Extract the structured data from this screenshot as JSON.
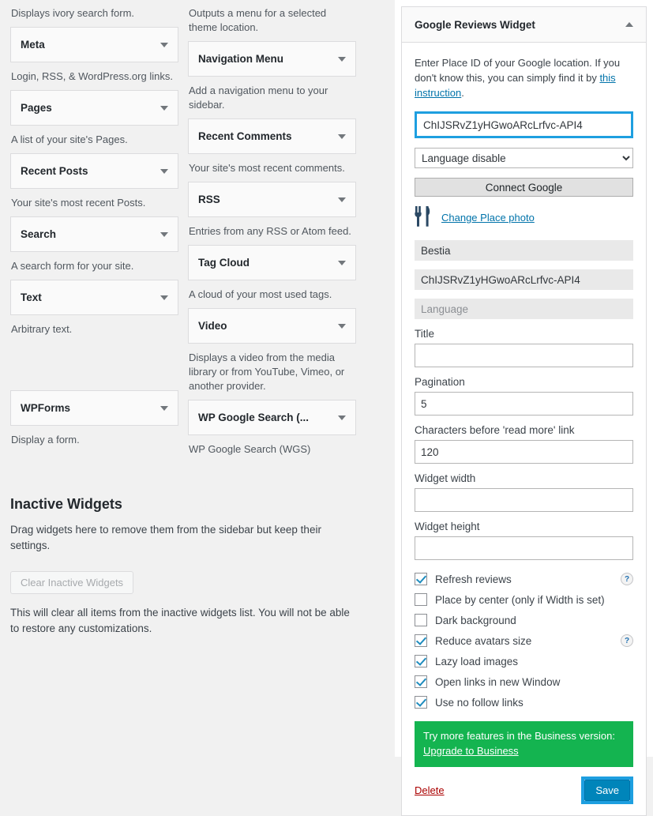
{
  "available_widgets": {
    "column_left": [
      {
        "desc_above": "Displays ivory search form.",
        "title": "Meta",
        "desc_below": "Login, RSS, & WordPress.org links."
      },
      {
        "title": "Pages",
        "desc_below": "A list of your site's Pages."
      },
      {
        "title": "Recent Posts",
        "desc_below": "Your site's most recent Posts."
      },
      {
        "title": "Search",
        "desc_below": "A search form for your site."
      },
      {
        "title": "Text",
        "desc_below": "Arbitrary text."
      },
      {
        "title": "WPForms",
        "desc_below": "Display a form."
      }
    ],
    "column_right": [
      {
        "desc_above": "Outputs a menu for a selected theme location.",
        "title": "Navigation Menu",
        "desc_below": "Add a navigation menu to your sidebar."
      },
      {
        "title": "Recent Comments",
        "desc_below": "Your site's most recent comments."
      },
      {
        "title": "RSS",
        "desc_below": "Entries from any RSS or Atom feed."
      },
      {
        "title": "Tag Cloud",
        "desc_below": "A cloud of your most used tags."
      },
      {
        "title": "Video",
        "desc_below": "Displays a video from the media library or from YouTube, Vimeo, or another provider."
      },
      {
        "title": "WP Google Search (...",
        "desc_below": "WP Google Search (WGS)"
      }
    ]
  },
  "inactive": {
    "heading": "Inactive Widgets",
    "description": "Drag widgets here to remove them from the sidebar but keep their settings.",
    "clear_button": "Clear Inactive Widgets",
    "note": "This will clear all items from the inactive widgets list. You will not be able to restore any customizations."
  },
  "widget_panel": {
    "title": "Google Reviews Widget",
    "collapse_icon": "chevron-up-icon",
    "intro_text_part1": "Enter Place ID of your Google location. If you don't know this, you can simply find it by ",
    "intro_link": "this instruction",
    "intro_text_part2": ".",
    "place_id_value": "ChIJSRvZ1yHGwoARcLrfvc-API4",
    "language_select_value": "Language disable",
    "language_options": [
      "Language disable"
    ],
    "connect_button": "Connect Google",
    "change_photo_link": "Change Place photo",
    "place_icon": "fork-and-knife-icon",
    "place_name_value": "Bestia",
    "place_id_readonly_value": "ChIJSRvZ1yHGwoARcLrfvc-API4",
    "language_placeholder": "Language",
    "fields": [
      {
        "label": "Title",
        "value": ""
      },
      {
        "label": "Pagination",
        "value": "5"
      },
      {
        "label": "Characters before 'read more' link",
        "value": "120"
      },
      {
        "label": "Widget width",
        "value": ""
      },
      {
        "label": "Widget height",
        "value": ""
      }
    ],
    "checkboxes": [
      {
        "label": "Refresh reviews",
        "checked": true,
        "help": "?"
      },
      {
        "label": "Place by center (only if Width is set)",
        "checked": false,
        "help": ""
      },
      {
        "label": "Dark background",
        "checked": false,
        "help": ""
      },
      {
        "label": "Reduce avatars size",
        "checked": true,
        "help": "?"
      },
      {
        "label": "Lazy load images",
        "checked": true,
        "help": ""
      },
      {
        "label": "Open links in new Window",
        "checked": true,
        "help": ""
      },
      {
        "label": "Use no follow links",
        "checked": true,
        "help": ""
      }
    ],
    "upgrade_text": "Try more features in the Business version:",
    "upgrade_link": "Upgrade to Business",
    "delete_link": "Delete",
    "save_button": "Save"
  },
  "colors": {
    "page_bg": "#f1f1f1",
    "highlight_blue": "#1e9fe0",
    "save_blue": "#0085ba",
    "link_blue": "#0073aa",
    "upgrade_green": "#14b450",
    "delete_red": "#a00000",
    "checkbox_blue": "#1e8cbe"
  }
}
